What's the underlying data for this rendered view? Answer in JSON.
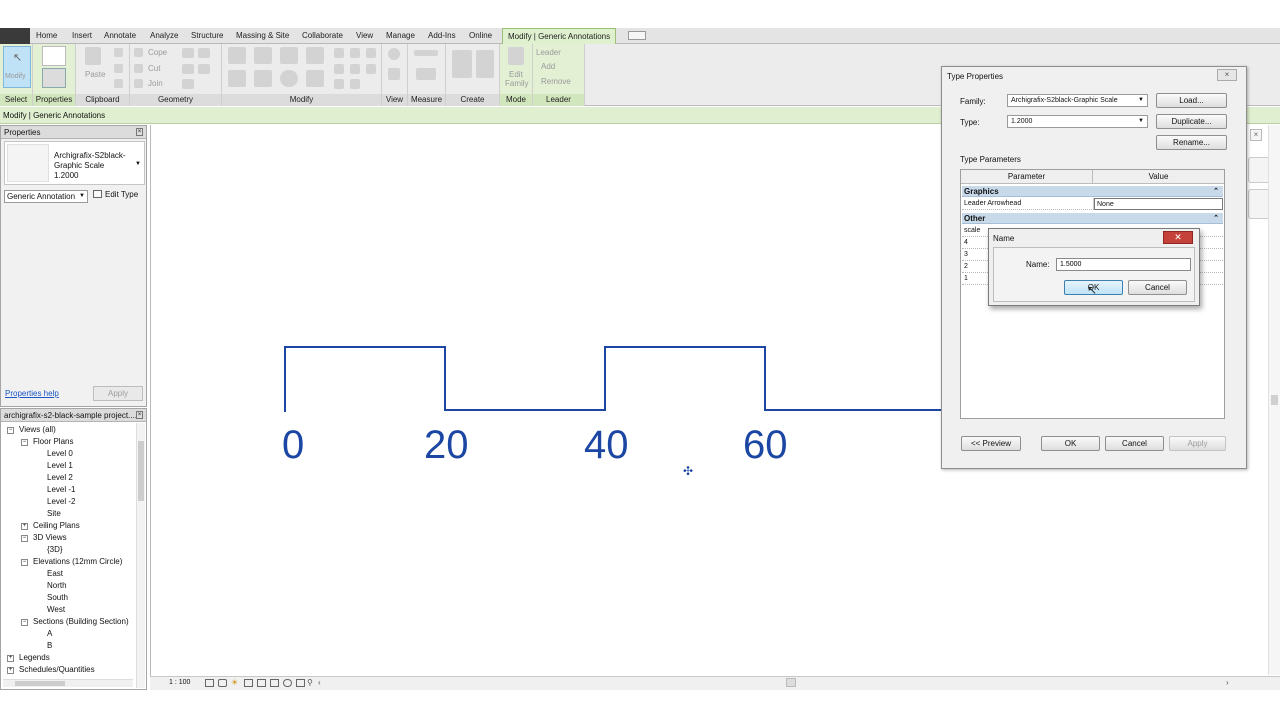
{
  "ribbon_tabs": [
    "Home",
    "Insert",
    "Annotate",
    "Analyze",
    "Structure",
    "Massing & Site",
    "Collaborate",
    "View",
    "Manage",
    "Add-Ins",
    "Online",
    "Modify | Generic Annotations"
  ],
  "ribbon_panels": {
    "select": "Select",
    "properties": "Properties",
    "clipboard": "Clipboard",
    "geometry": "Geometry",
    "modify": "Modify",
    "view": "View",
    "measure": "Measure",
    "create": "Create",
    "mode": "Mode",
    "leader": "Leader"
  },
  "ribbon_buttons": {
    "modify": "Modify",
    "paste": "Paste",
    "cope": "Cope",
    "cut": "Cut",
    "join": "Join",
    "edit_family_1": "Edit",
    "edit_family_2": "Family",
    "leader": "Leader",
    "add": "Add",
    "remove": "Remove"
  },
  "context_bar": "Modify | Generic Annotations",
  "properties": {
    "title": "Properties",
    "type_name": "Archigrafix-S2black-Graphic Scale",
    "type_value": "1.2000",
    "category": "Generic Annotation",
    "edit_type": "Edit Type",
    "help": "Properties help",
    "apply": "Apply"
  },
  "browser": {
    "title": "archigrafix-s2-black-sample project....",
    "items": [
      {
        "label": "Views (all)",
        "level": 0
      },
      {
        "label": "Floor Plans",
        "level": 1
      },
      {
        "label": "Level 0",
        "level": 2
      },
      {
        "label": "Level 1",
        "level": 2
      },
      {
        "label": "Level 2",
        "level": 2
      },
      {
        "label": "Level -1",
        "level": 2
      },
      {
        "label": "Level -2",
        "level": 2
      },
      {
        "label": "Site",
        "level": 2
      },
      {
        "label": "Ceiling Plans",
        "level": 1
      },
      {
        "label": "3D Views",
        "level": 1
      },
      {
        "label": "{3D}",
        "level": 2
      },
      {
        "label": "Elevations (12mm Circle)",
        "level": 1
      },
      {
        "label": "East",
        "level": 2
      },
      {
        "label": "North",
        "level": 2
      },
      {
        "label": "South",
        "level": 2
      },
      {
        "label": "West",
        "level": 2
      },
      {
        "label": "Sections (Building Section)",
        "level": 1
      },
      {
        "label": "A",
        "level": 2
      },
      {
        "label": "B",
        "level": 2
      },
      {
        "label": "Legends",
        "level": 0
      },
      {
        "label": "Schedules/Quantities",
        "level": 0
      }
    ]
  },
  "canvas": {
    "scale_labels": [
      "0",
      "20",
      "40",
      "60"
    ],
    "line_color": "#1b46a3"
  },
  "status": {
    "scale": "1 : 100"
  },
  "type_dialog": {
    "title": "Type Properties",
    "family_label": "Family:",
    "family_value": "Archigrafix-S2black-Graphic Scale",
    "type_label": "Type:",
    "type_value": "1.2000",
    "load": "Load...",
    "duplicate": "Duplicate...",
    "rename": "Rename...",
    "type_parameters": "Type Parameters",
    "col_parameter": "Parameter",
    "col_value": "Value",
    "group_graphics": "Graphics",
    "leader_arrowhead_param": "Leader Arrowhead",
    "leader_arrowhead_value": "None",
    "group_other": "Other",
    "other_rows": [
      "scale",
      "4",
      "3",
      "2",
      "1"
    ],
    "preview": "<< Preview",
    "ok": "OK",
    "cancel": "Cancel",
    "apply": "Apply"
  },
  "name_dialog": {
    "title": "Name",
    "name_label": "Name:",
    "name_value": "1.5000",
    "ok": "OK",
    "cancel": "Cancel"
  }
}
